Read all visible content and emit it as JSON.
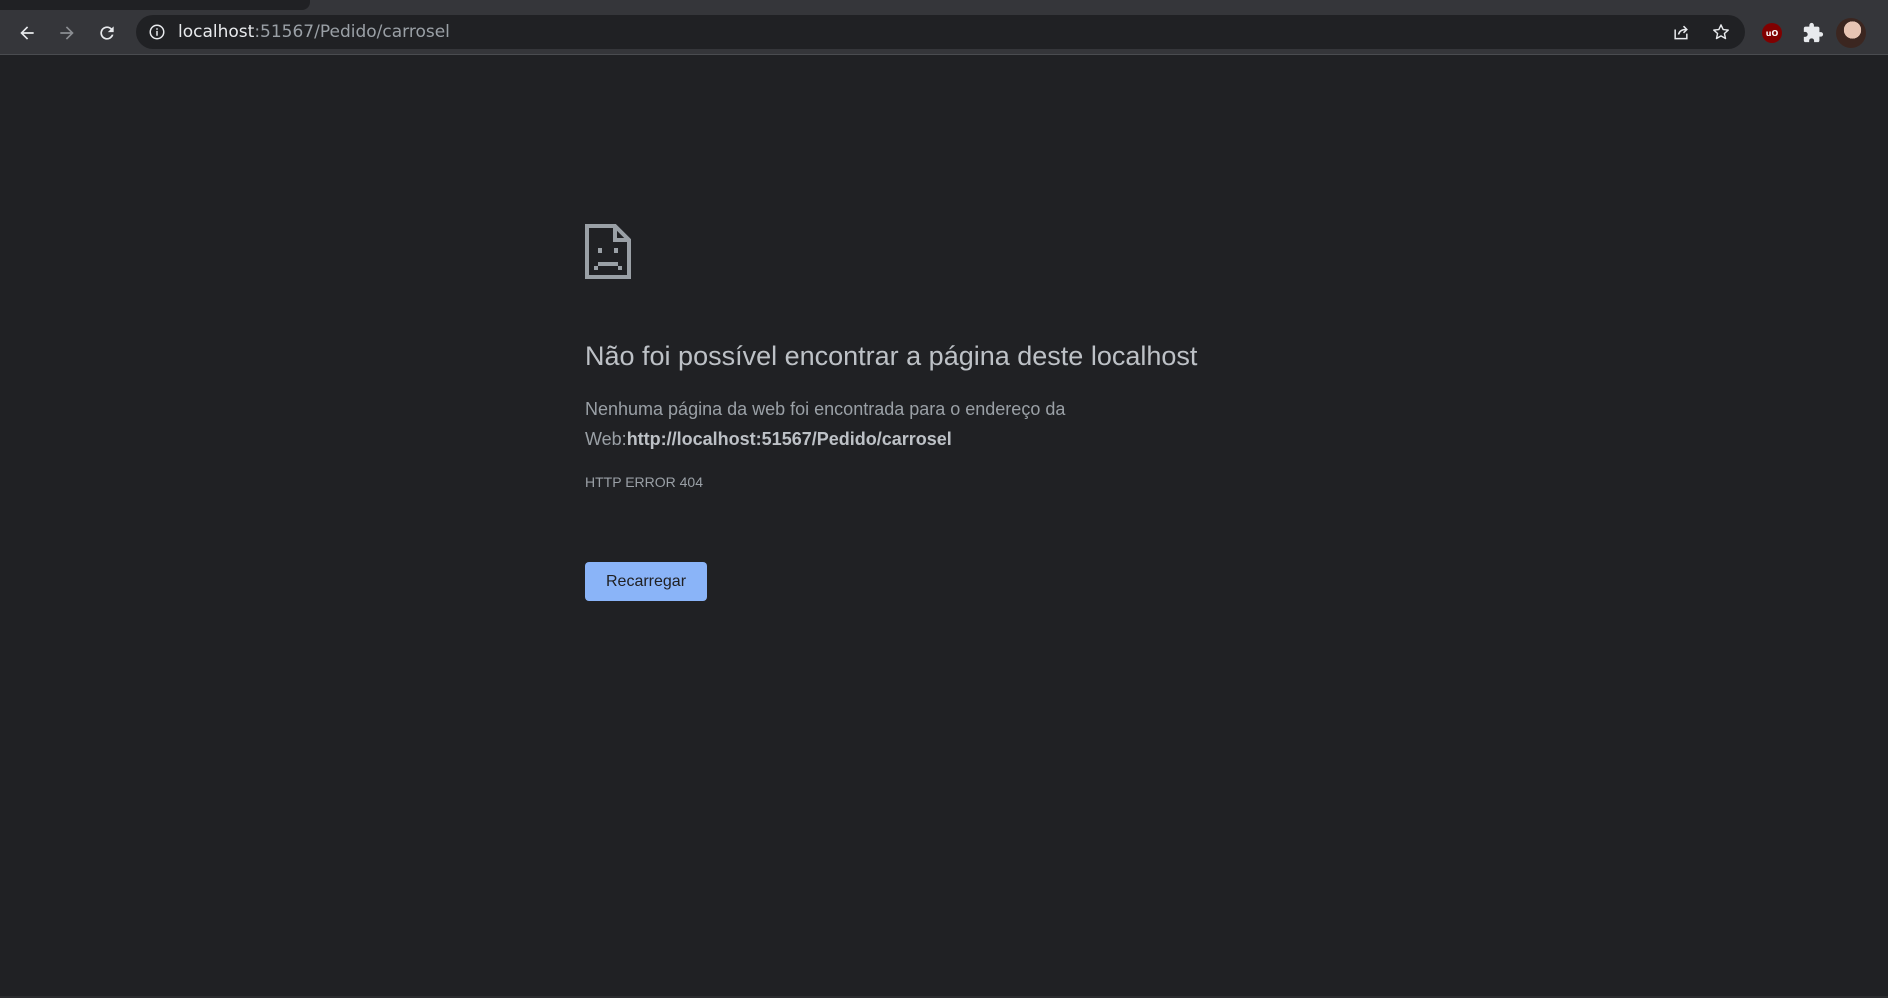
{
  "browser": {
    "url_host": "localhost",
    "url_rest": ":51567/Pedido/carrosel"
  },
  "error_page": {
    "headline": "Não foi possível encontrar a página deste localhost",
    "summary_prefix": "Nenhuma página da web foi encontrada para o endereço da Web:",
    "summary_url": "http://localhost:51567/Pedido/carrosel",
    "error_code": "HTTP ERROR 404",
    "reload_label": "Recarregar"
  },
  "extensions": {
    "ublock_label": "uO"
  },
  "colors": {
    "page_background": "#202124",
    "toolbar_background": "#35363a",
    "button_blue": "#8ab4f8",
    "headline_text": "#bdc1c6",
    "body_text": "#9aa0a6"
  }
}
